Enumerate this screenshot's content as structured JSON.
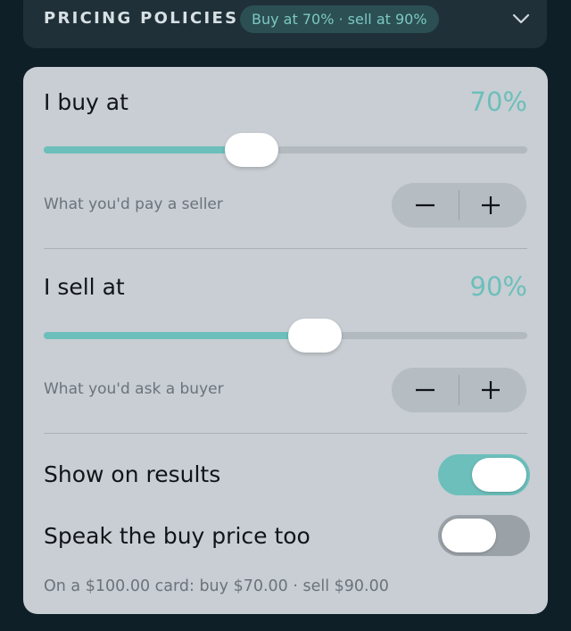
{
  "header": {
    "title": "PRICING POLICIES",
    "badge": "Buy at 70% · sell at 90%",
    "expand_icon": "chevron-down-icon"
  },
  "buy": {
    "label": "I buy at",
    "value": "70%",
    "slider_fraction": 0.43,
    "hint": "What you'd pay a seller"
  },
  "sell": {
    "label": "I sell at",
    "value": "90%",
    "slider_fraction": 0.56,
    "hint": "What you'd ask a buyer"
  },
  "stepper_icons": {
    "minus": "minus-icon",
    "plus": "plus-icon"
  },
  "toggles": {
    "show_results": {
      "label": "Show on results",
      "on": true
    },
    "speak_buy": {
      "label": "Speak the buy price too",
      "on": false
    }
  },
  "example": "On a $100.00 card: buy $70.00 · sell $90.00",
  "colors": {
    "accent": "#6cbfbb",
    "background": "#0f1f28",
    "card": "#c8ced3",
    "toggle_off": "#9aa1a7"
  }
}
